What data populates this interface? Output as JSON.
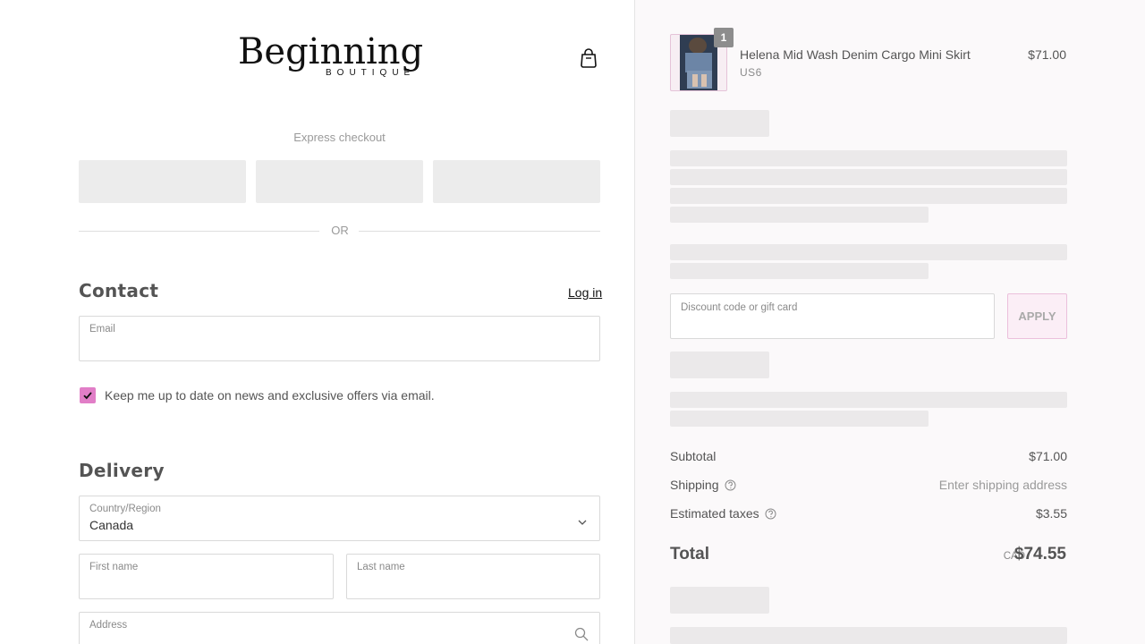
{
  "brand": {
    "name": "Beginning",
    "tagline": "BOUTIQUE"
  },
  "express": {
    "label": "Express checkout",
    "divider": "OR"
  },
  "contact": {
    "title": "Contact",
    "login_label": "Log in",
    "email": {
      "label": "Email",
      "value": ""
    },
    "newsletter": {
      "label": "Keep me up to date on news and exclusive offers via email.",
      "checked": true
    }
  },
  "delivery": {
    "title": "Delivery",
    "country": {
      "label": "Country/Region",
      "value": "Canada"
    },
    "first_name": {
      "label": "First name",
      "value": ""
    },
    "last_name": {
      "label": "Last name",
      "value": ""
    },
    "address": {
      "label": "Address",
      "value": ""
    }
  },
  "cart": {
    "item": {
      "name": "Helena Mid Wash Denim Cargo Mini Skirt",
      "variant": "US6",
      "price": "$71.00",
      "quantity": "1"
    },
    "discount": {
      "placeholder": "Discount code or gift card",
      "apply_label": "APPLY"
    },
    "summary": {
      "subtotal_label": "Subtotal",
      "subtotal_value": "$71.00",
      "shipping_label": "Shipping",
      "shipping_value": "Enter shipping address",
      "taxes_label": "Estimated taxes",
      "taxes_value": "$3.55",
      "total_label": "Total",
      "currency": "CAD",
      "total_value": "$74.55"
    }
  },
  "colors": {
    "accent": "#e17ec7",
    "skeleton": "#ebe9ea",
    "sidebar_bg": "#fbf9fa"
  }
}
